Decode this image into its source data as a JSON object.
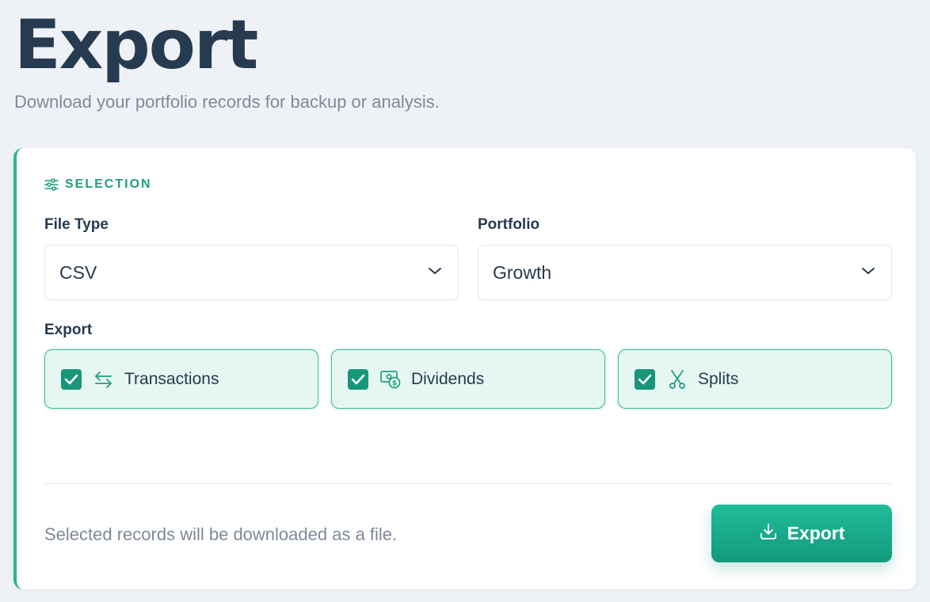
{
  "header": {
    "title": "Export",
    "subtitle": "Download your portfolio records for backup or analysis."
  },
  "selection": {
    "section_label": "SELECTION",
    "section_icon": "sliders-icon",
    "file_type": {
      "label": "File Type",
      "value": "CSV"
    },
    "portfolio": {
      "label": "Portfolio",
      "value": "Growth"
    },
    "export_label": "Export",
    "options": [
      {
        "label": "Transactions",
        "icon": "arrows-swap-icon",
        "checked": true
      },
      {
        "label": "Dividends",
        "icon": "cash-icon",
        "checked": true
      },
      {
        "label": "Splits",
        "icon": "scissors-icon",
        "checked": true
      }
    ]
  },
  "footer": {
    "note": "Selected records will be downloaded as a file.",
    "button_label": "Export",
    "button_icon": "download-icon"
  },
  "colors": {
    "accent": "#1f9e80",
    "title": "#263a50",
    "muted": "#7e8a99",
    "option_bg": "#e6f7f2",
    "background": "#eef1f6"
  }
}
